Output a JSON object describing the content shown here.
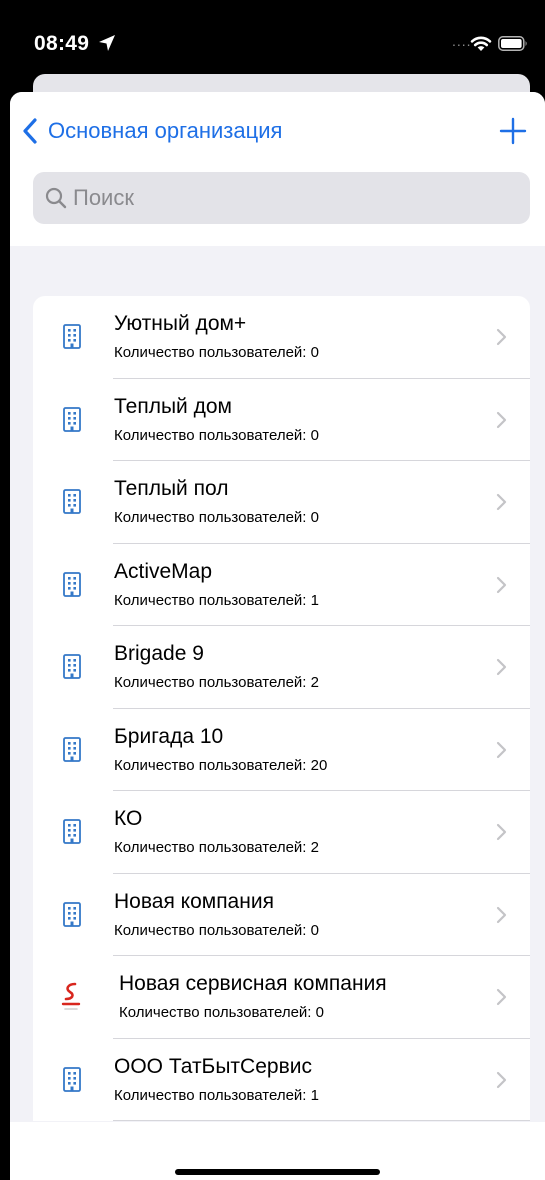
{
  "status_bar": {
    "time": "08:49",
    "signal_dots": "...."
  },
  "nav": {
    "back_label": "Основная организация",
    "add_icon": "plus-icon",
    "accent_color": "#1e6fe6"
  },
  "search": {
    "placeholder": "Поиск",
    "value": ""
  },
  "organizations": [
    {
      "name": "Уютный дом+",
      "subtitle": "Количество пользователей: 0",
      "icon": "building-icon"
    },
    {
      "name": "Теплый дом",
      "subtitle": "Количество пользователей: 0",
      "icon": "building-icon"
    },
    {
      "name": "Теплый пол",
      "subtitle": "Количество пользователей: 0",
      "icon": "building-icon"
    },
    {
      "name": "ActiveMap",
      "subtitle": "Количество пользователей: 1",
      "icon": "building-icon"
    },
    {
      "name": "Brigade 9",
      "subtitle": "Количество пользователей: 2",
      "icon": "building-icon"
    },
    {
      "name": "Бригада 10",
      "subtitle": "Количество пользователей: 20",
      "icon": "building-icon"
    },
    {
      "name": "КО",
      "subtitle": "Количество пользователей: 2",
      "icon": "building-icon"
    },
    {
      "name": "Новая компания",
      "subtitle": "Количество пользователей: 0",
      "icon": "building-icon"
    },
    {
      "name": "Новая сервисная компания",
      "subtitle": "Количество пользователей: 0",
      "icon": "service-logo-icon"
    },
    {
      "name": "ООО ТатБытСервис",
      "subtitle": "Количество пользователей: 1",
      "icon": "building-icon"
    }
  ]
}
